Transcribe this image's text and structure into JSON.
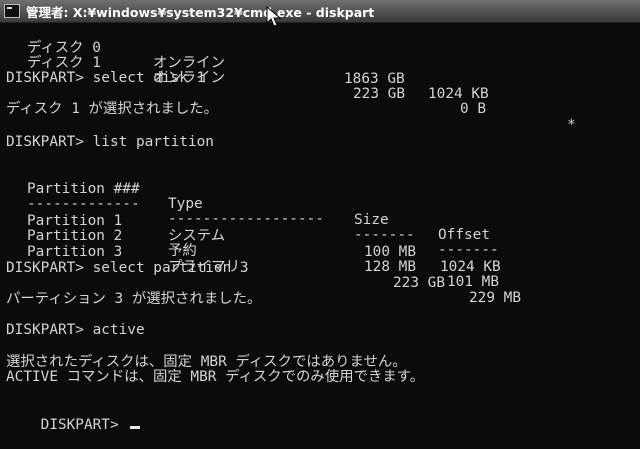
{
  "window": {
    "title": "管理者: X:¥windows¥system32¥cmd.exe - diskpart"
  },
  "disk_list": [
    {
      "name": "ディスク 0",
      "status": "オンライン",
      "size": "1863 GB",
      "free": "1024 KB",
      "gpt": ""
    },
    {
      "name": "ディスク 1",
      "status": "オンライン",
      "size": "223 GB",
      "free": "0 B",
      "gpt": "*"
    }
  ],
  "console": {
    "cmd_select_disk": "DISKPART> select disk 1",
    "msg_disk_selected": "ディスク 1 が選択されました。",
    "cmd_list_partition": "DISKPART> list partition",
    "partition_header": {
      "col1": "Partition ###",
      "col2": "Type",
      "col3": "Size",
      "col4": "Offset"
    },
    "partition_sep": {
      "col1": "-------------",
      "col2": "------------------",
      "col3": "-------",
      "col4": "-------"
    },
    "partitions": [
      {
        "name": "Partition 1",
        "type": "システム",
        "size": "100 MB",
        "offset": "1024 KB"
      },
      {
        "name": "Partition 2",
        "type": "予約",
        "size": "128 MB",
        "offset": "101 MB"
      },
      {
        "name": "Partition 3",
        "type": "プライマリ",
        "size": "223 GB",
        "offset": "229 MB"
      }
    ],
    "cmd_select_partition": "DISKPART> select partition 3",
    "msg_partition_selected": "パーティション 3 が選択されました。",
    "cmd_active": "DISKPART> active",
    "msg_error_1": "選択されたディスクは、固定 MBR ディスクではありません。",
    "msg_error_2": "ACTIVE コマンドは、固定 MBR ディスクでのみ使用できます。",
    "prompt": "DISKPART> "
  }
}
